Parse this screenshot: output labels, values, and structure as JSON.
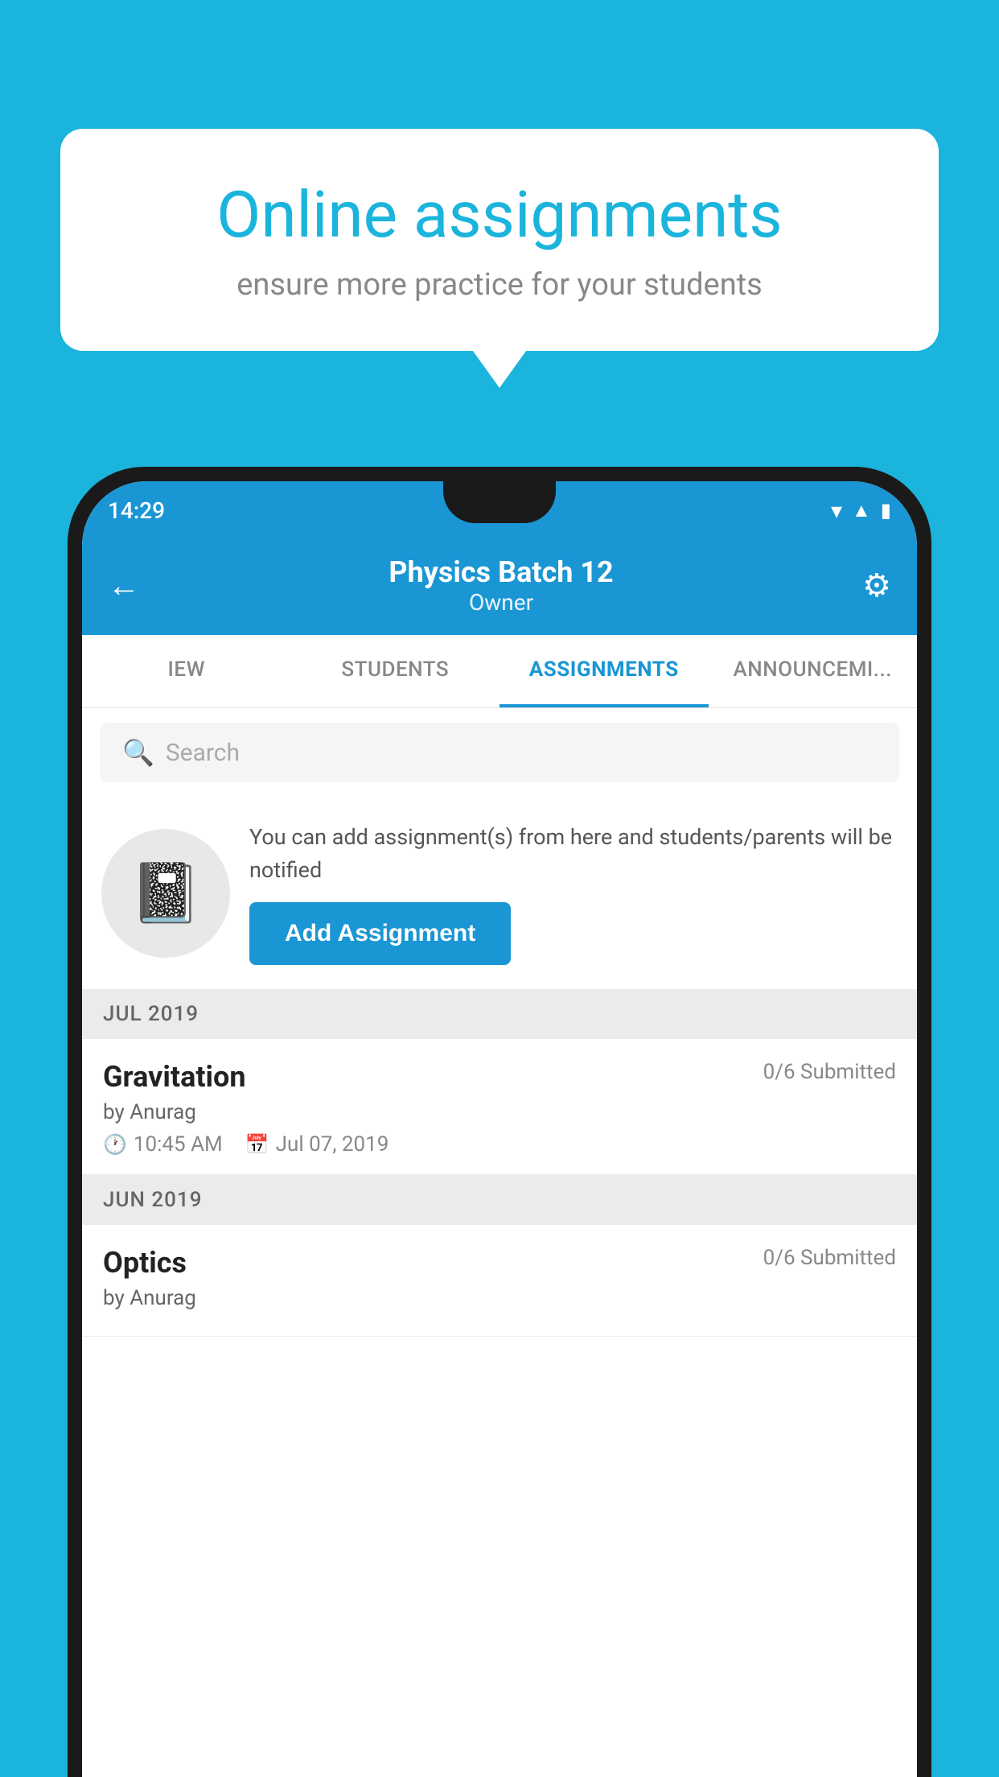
{
  "background_color": "#1ab4dc",
  "speech_bubble": {
    "title": "Online assignments",
    "subtitle": "ensure more practice for your students"
  },
  "status_bar": {
    "time": "14:29",
    "wifi_icon": "▾",
    "signal_icon": "▲",
    "battery_icon": "▮"
  },
  "header": {
    "title": "Physics Batch 12",
    "subtitle": "Owner",
    "back_label": "←",
    "settings_label": "⚙"
  },
  "tabs": [
    {
      "label": "IEW",
      "active": false
    },
    {
      "label": "STUDENTS",
      "active": false
    },
    {
      "label": "ASSIGNMENTS",
      "active": true
    },
    {
      "label": "ANNOUNCEM...",
      "active": false
    }
  ],
  "search": {
    "placeholder": "Search",
    "search_icon": "🔍"
  },
  "add_assignment": {
    "description": "You can add assignment(s) from here and students/parents will be notified",
    "button_label": "Add Assignment",
    "icon": "📓"
  },
  "sections": [
    {
      "header": "JUL 2019",
      "assignments": [
        {
          "title": "Gravitation",
          "submitted": "0/6 Submitted",
          "author": "by Anurag",
          "time": "10:45 AM",
          "date": "Jul 07, 2019"
        }
      ]
    },
    {
      "header": "JUN 2019",
      "assignments": [
        {
          "title": "Optics",
          "submitted": "0/6 Submitted",
          "author": "by Anurag",
          "time": "",
          "date": ""
        }
      ]
    }
  ]
}
